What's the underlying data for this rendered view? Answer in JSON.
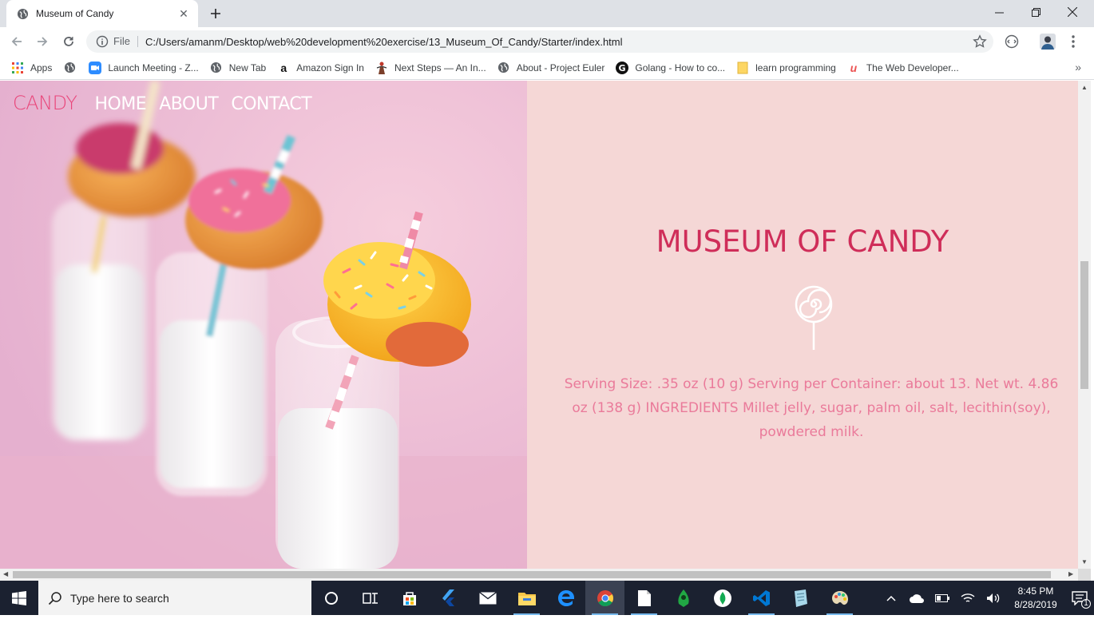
{
  "browser": {
    "tab_title": "Museum of Candy",
    "url_scheme": "File",
    "url": "C:/Users/amanm/Desktop/web%20development%20exercise/13_Museum_Of_Candy/Starter/index.html",
    "icons": [
      "globe-icon",
      "close-icon",
      "plus-icon",
      "back-icon",
      "forward-icon",
      "reload-icon",
      "info-icon",
      "star-icon",
      "extension-icon",
      "profile-icon",
      "menu-icon"
    ],
    "bookmarks": [
      {
        "label": "Apps",
        "icon": "apps-grid-icon"
      },
      {
        "label": "",
        "icon": "globe-icon"
      },
      {
        "label": "Launch Meeting - Z...",
        "icon": "zoom-icon"
      },
      {
        "label": "New Tab",
        "icon": "globe-icon"
      },
      {
        "label": "Amazon Sign In",
        "icon": "amazon-icon"
      },
      {
        "label": "Next Steps — An In...",
        "icon": "figure-icon"
      },
      {
        "label": "About - Project Euler",
        "icon": "globe-icon"
      },
      {
        "label": "Golang - How to co...",
        "icon": "g-icon"
      },
      {
        "label": "learn programming",
        "icon": "folder-icon"
      },
      {
        "label": "The Web Developer...",
        "icon": "udemy-icon"
      }
    ]
  },
  "page": {
    "nav": {
      "brand": "CANDY",
      "links": [
        "HOME",
        "ABOUT",
        "CONTACT"
      ]
    },
    "title": "MUSEUM OF CANDY",
    "description": "Serving Size: .35 oz (10 g) Serving per Container: about 13. Net wt. 4.86 oz (138 g) INGREDIENTS Millet jelly, sugar, palm oil, salt, lecithin(soy), powdered milk.",
    "colors": {
      "brand": "#e9467a",
      "title": "#cf2d59",
      "description": "#ea7a9a",
      "right_panel_bg": "#f5d7d6"
    }
  },
  "taskbar": {
    "search_placeholder": "Type here to search",
    "time": "8:45 PM",
    "date": "8/28/2019",
    "notification_count": "1",
    "apps": [
      "cortana-icon",
      "task-view-icon",
      "store-icon",
      "flutter-icon",
      "mail-icon",
      "file-explorer-icon",
      "edge-icon",
      "chrome-icon",
      "notepad-icon",
      "robo3t-icon",
      "mongodb-icon",
      "vscode-icon",
      "notepadpp-icon",
      "paint-icon"
    ]
  }
}
